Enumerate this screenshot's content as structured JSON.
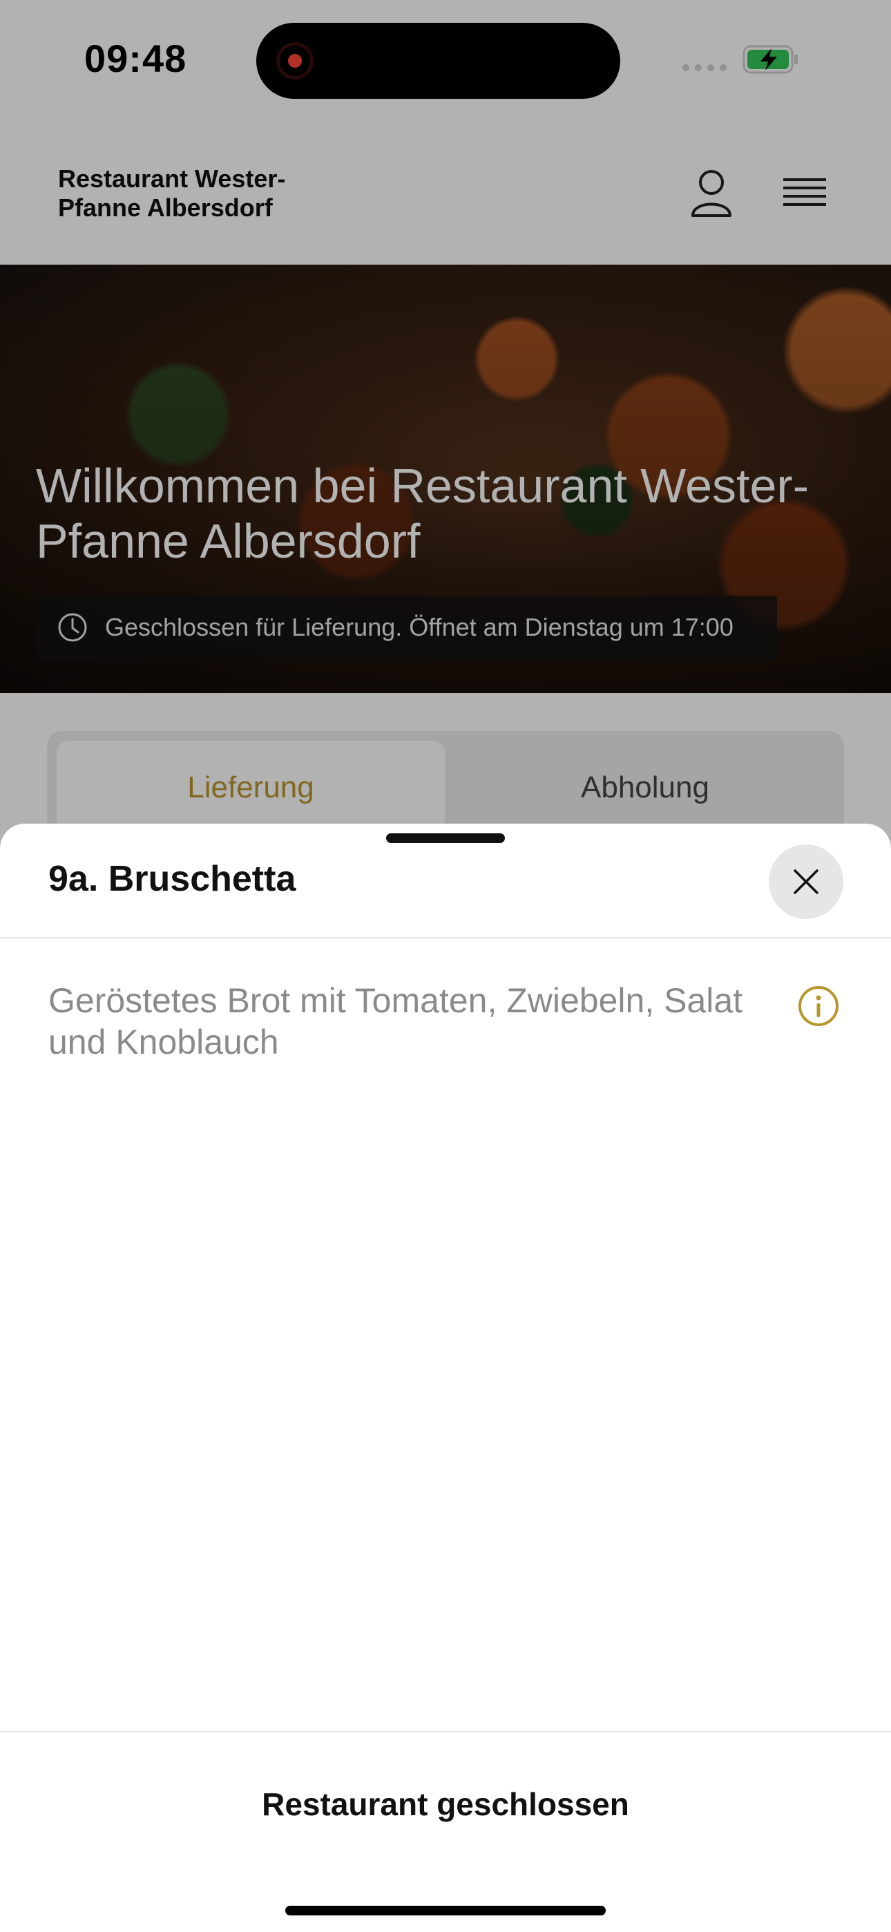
{
  "status_bar": {
    "time": "09:48",
    "recording_icon": "screen-recording-icon",
    "signal_icon": "cellular-signal-icon",
    "battery_icon": "battery-charging-icon",
    "battery_color": "#34c759"
  },
  "header": {
    "brand_line1": "Restaurant Wester-",
    "brand_line2": "Pfanne Albersdorf",
    "account_icon": "user-icon",
    "menu_icon": "hamburger-menu-icon"
  },
  "hero": {
    "title": "Willkommen bei Restaurant Wester-Pfanne Albersdorf",
    "status_icon": "clock-icon",
    "status_text": "Geschlossen für Lieferung. Öffnet am Dienstag um 17:00"
  },
  "order_mode_tabs": [
    {
      "label": "Lieferung",
      "active": true
    },
    {
      "label": "Abholung",
      "active": false
    }
  ],
  "sheet": {
    "title": "9a. Bruschetta",
    "close_icon": "close-icon",
    "description": "Geröstetes Brot mit Tomaten, Zwiebeln, Salat und Knoblauch",
    "info_icon": "info-icon",
    "footer_status": "Restaurant geschlossen"
  },
  "colors": {
    "accent_gold": "#b8962e",
    "dim_overlay": "rgba(0,0,0,0.30)",
    "sheet_background": "#ffffff"
  }
}
